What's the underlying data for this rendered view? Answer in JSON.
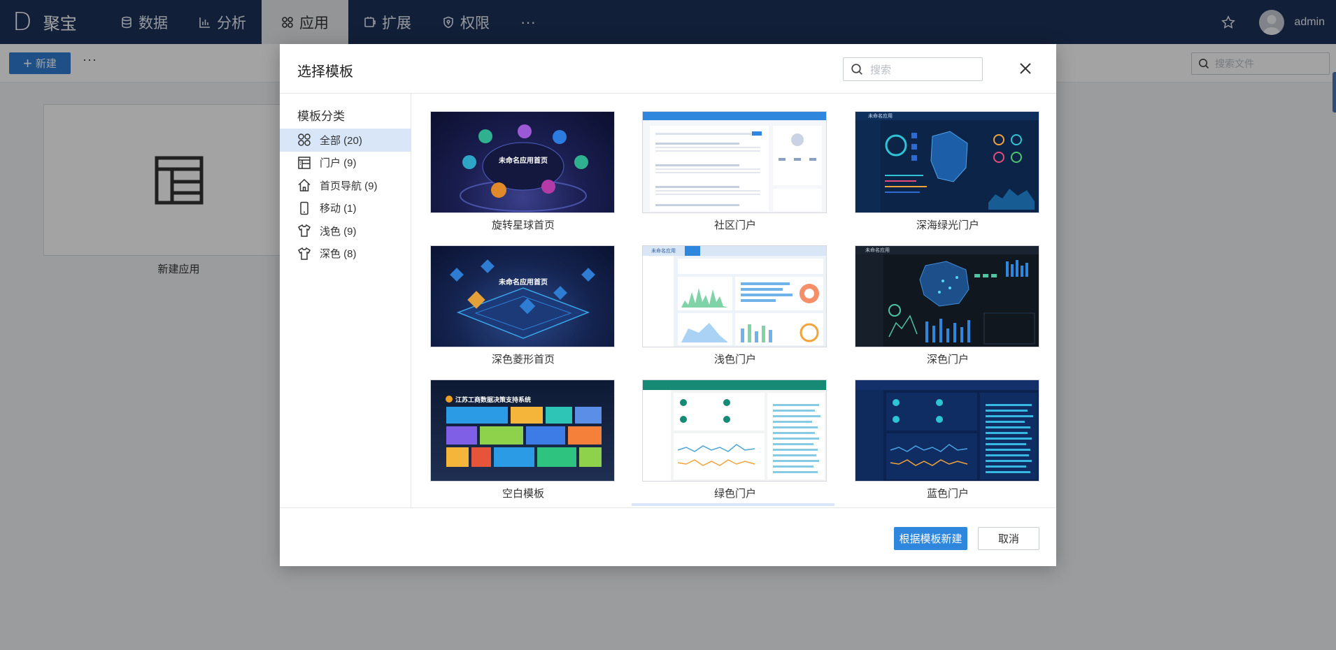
{
  "topbar": {
    "logo": "D",
    "app_name": "聚宝",
    "nav": [
      {
        "label": "数据",
        "icon": "database-icon"
      },
      {
        "label": "分析",
        "icon": "bar-chart-icon"
      },
      {
        "label": "应用",
        "icon": "apps-icon",
        "active": true
      },
      {
        "label": "扩展",
        "icon": "extension-icon"
      },
      {
        "label": "权限",
        "icon": "shield-icon"
      }
    ],
    "more": "···",
    "user": "admin"
  },
  "toolbar": {
    "new_label": "新建",
    "more": "···",
    "file_search_placeholder": "搜索文件"
  },
  "workspace": {
    "app_card_label": "新建应用"
  },
  "modal": {
    "title": "选择模板",
    "search_placeholder": "搜索",
    "sidebar_title": "模板分类",
    "categories": [
      {
        "label": "全部 (20)",
        "icon": "apps-icon",
        "active": true
      },
      {
        "label": "门户 (9)",
        "icon": "portal-icon"
      },
      {
        "label": "首页导航 (9)",
        "icon": "home-icon"
      },
      {
        "label": "移动 (1)",
        "icon": "mobile-icon"
      },
      {
        "label": "浅色 (9)",
        "icon": "shirt-icon"
      },
      {
        "label": "深色 (8)",
        "icon": "shirt-icon"
      }
    ],
    "templates": [
      {
        "label": "旋转星球首页",
        "thumb_title": "未命名应用首页"
      },
      {
        "label": "社区门户"
      },
      {
        "label": "深海绿光门户",
        "thumb_title": "未命名应用"
      },
      {
        "label": "深色菱形首页",
        "thumb_title": "未命名应用首页"
      },
      {
        "label": "浅色门户",
        "thumb_title": "未命名应用"
      },
      {
        "label": "深色门户",
        "thumb_title": "未命名应用"
      },
      {
        "label": "空白模板",
        "thumb_title": "江苏工商数据决策支持系统"
      },
      {
        "label": "绿色门户"
      },
      {
        "label": "蓝色门户"
      }
    ],
    "primary_button": "根据模板新建",
    "cancel_button": "取消"
  },
  "colors": {
    "topbar_bg": "#1c3158",
    "primary": "#2f86dd",
    "category_active_bg": "#d8e6f8"
  }
}
